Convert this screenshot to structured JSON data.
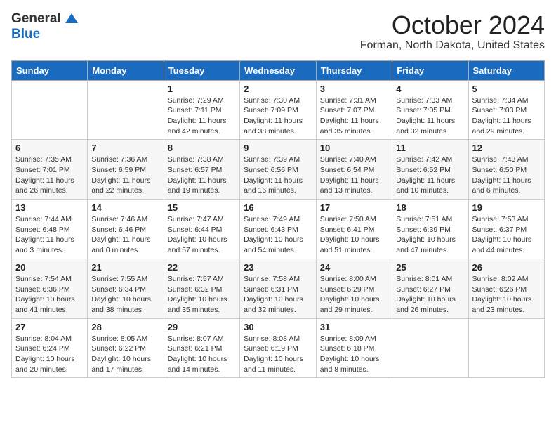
{
  "logo": {
    "general": "General",
    "blue": "Blue"
  },
  "header": {
    "month": "October 2024",
    "location": "Forman, North Dakota, United States"
  },
  "weekdays": [
    "Sunday",
    "Monday",
    "Tuesday",
    "Wednesday",
    "Thursday",
    "Friday",
    "Saturday"
  ],
  "weeks": [
    [
      {
        "day": "",
        "sunrise": "",
        "sunset": "",
        "daylight": ""
      },
      {
        "day": "",
        "sunrise": "",
        "sunset": "",
        "daylight": ""
      },
      {
        "day": "1",
        "sunrise": "Sunrise: 7:29 AM",
        "sunset": "Sunset: 7:11 PM",
        "daylight": "Daylight: 11 hours and 42 minutes."
      },
      {
        "day": "2",
        "sunrise": "Sunrise: 7:30 AM",
        "sunset": "Sunset: 7:09 PM",
        "daylight": "Daylight: 11 hours and 38 minutes."
      },
      {
        "day": "3",
        "sunrise": "Sunrise: 7:31 AM",
        "sunset": "Sunset: 7:07 PM",
        "daylight": "Daylight: 11 hours and 35 minutes."
      },
      {
        "day": "4",
        "sunrise": "Sunrise: 7:33 AM",
        "sunset": "Sunset: 7:05 PM",
        "daylight": "Daylight: 11 hours and 32 minutes."
      },
      {
        "day": "5",
        "sunrise": "Sunrise: 7:34 AM",
        "sunset": "Sunset: 7:03 PM",
        "daylight": "Daylight: 11 hours and 29 minutes."
      }
    ],
    [
      {
        "day": "6",
        "sunrise": "Sunrise: 7:35 AM",
        "sunset": "Sunset: 7:01 PM",
        "daylight": "Daylight: 11 hours and 26 minutes."
      },
      {
        "day": "7",
        "sunrise": "Sunrise: 7:36 AM",
        "sunset": "Sunset: 6:59 PM",
        "daylight": "Daylight: 11 hours and 22 minutes."
      },
      {
        "day": "8",
        "sunrise": "Sunrise: 7:38 AM",
        "sunset": "Sunset: 6:57 PM",
        "daylight": "Daylight: 11 hours and 19 minutes."
      },
      {
        "day": "9",
        "sunrise": "Sunrise: 7:39 AM",
        "sunset": "Sunset: 6:56 PM",
        "daylight": "Daylight: 11 hours and 16 minutes."
      },
      {
        "day": "10",
        "sunrise": "Sunrise: 7:40 AM",
        "sunset": "Sunset: 6:54 PM",
        "daylight": "Daylight: 11 hours and 13 minutes."
      },
      {
        "day": "11",
        "sunrise": "Sunrise: 7:42 AM",
        "sunset": "Sunset: 6:52 PM",
        "daylight": "Daylight: 11 hours and 10 minutes."
      },
      {
        "day": "12",
        "sunrise": "Sunrise: 7:43 AM",
        "sunset": "Sunset: 6:50 PM",
        "daylight": "Daylight: 11 hours and 6 minutes."
      }
    ],
    [
      {
        "day": "13",
        "sunrise": "Sunrise: 7:44 AM",
        "sunset": "Sunset: 6:48 PM",
        "daylight": "Daylight: 11 hours and 3 minutes."
      },
      {
        "day": "14",
        "sunrise": "Sunrise: 7:46 AM",
        "sunset": "Sunset: 6:46 PM",
        "daylight": "Daylight: 11 hours and 0 minutes."
      },
      {
        "day": "15",
        "sunrise": "Sunrise: 7:47 AM",
        "sunset": "Sunset: 6:44 PM",
        "daylight": "Daylight: 10 hours and 57 minutes."
      },
      {
        "day": "16",
        "sunrise": "Sunrise: 7:49 AM",
        "sunset": "Sunset: 6:43 PM",
        "daylight": "Daylight: 10 hours and 54 minutes."
      },
      {
        "day": "17",
        "sunrise": "Sunrise: 7:50 AM",
        "sunset": "Sunset: 6:41 PM",
        "daylight": "Daylight: 10 hours and 51 minutes."
      },
      {
        "day": "18",
        "sunrise": "Sunrise: 7:51 AM",
        "sunset": "Sunset: 6:39 PM",
        "daylight": "Daylight: 10 hours and 47 minutes."
      },
      {
        "day": "19",
        "sunrise": "Sunrise: 7:53 AM",
        "sunset": "Sunset: 6:37 PM",
        "daylight": "Daylight: 10 hours and 44 minutes."
      }
    ],
    [
      {
        "day": "20",
        "sunrise": "Sunrise: 7:54 AM",
        "sunset": "Sunset: 6:36 PM",
        "daylight": "Daylight: 10 hours and 41 minutes."
      },
      {
        "day": "21",
        "sunrise": "Sunrise: 7:55 AM",
        "sunset": "Sunset: 6:34 PM",
        "daylight": "Daylight: 10 hours and 38 minutes."
      },
      {
        "day": "22",
        "sunrise": "Sunrise: 7:57 AM",
        "sunset": "Sunset: 6:32 PM",
        "daylight": "Daylight: 10 hours and 35 minutes."
      },
      {
        "day": "23",
        "sunrise": "Sunrise: 7:58 AM",
        "sunset": "Sunset: 6:31 PM",
        "daylight": "Daylight: 10 hours and 32 minutes."
      },
      {
        "day": "24",
        "sunrise": "Sunrise: 8:00 AM",
        "sunset": "Sunset: 6:29 PM",
        "daylight": "Daylight: 10 hours and 29 minutes."
      },
      {
        "day": "25",
        "sunrise": "Sunrise: 8:01 AM",
        "sunset": "Sunset: 6:27 PM",
        "daylight": "Daylight: 10 hours and 26 minutes."
      },
      {
        "day": "26",
        "sunrise": "Sunrise: 8:02 AM",
        "sunset": "Sunset: 6:26 PM",
        "daylight": "Daylight: 10 hours and 23 minutes."
      }
    ],
    [
      {
        "day": "27",
        "sunrise": "Sunrise: 8:04 AM",
        "sunset": "Sunset: 6:24 PM",
        "daylight": "Daylight: 10 hours and 20 minutes."
      },
      {
        "day": "28",
        "sunrise": "Sunrise: 8:05 AM",
        "sunset": "Sunset: 6:22 PM",
        "daylight": "Daylight: 10 hours and 17 minutes."
      },
      {
        "day": "29",
        "sunrise": "Sunrise: 8:07 AM",
        "sunset": "Sunset: 6:21 PM",
        "daylight": "Daylight: 10 hours and 14 minutes."
      },
      {
        "day": "30",
        "sunrise": "Sunrise: 8:08 AM",
        "sunset": "Sunset: 6:19 PM",
        "daylight": "Daylight: 10 hours and 11 minutes."
      },
      {
        "day": "31",
        "sunrise": "Sunrise: 8:09 AM",
        "sunset": "Sunset: 6:18 PM",
        "daylight": "Daylight: 10 hours and 8 minutes."
      },
      {
        "day": "",
        "sunrise": "",
        "sunset": "",
        "daylight": ""
      },
      {
        "day": "",
        "sunrise": "",
        "sunset": "",
        "daylight": ""
      }
    ]
  ]
}
